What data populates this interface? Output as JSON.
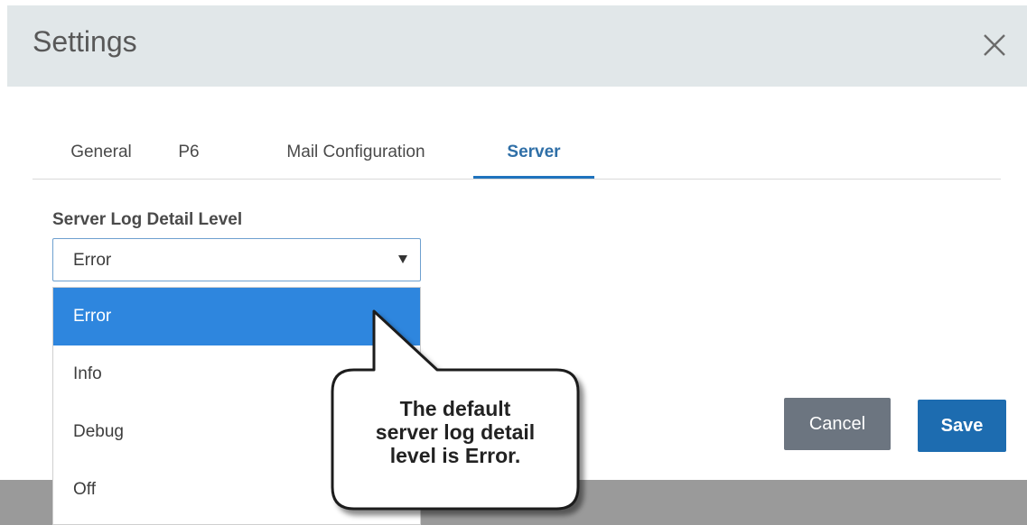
{
  "dialog": {
    "title": "Settings",
    "close_icon": "close-icon"
  },
  "tabs": [
    {
      "label": "General",
      "active": false
    },
    {
      "label": "P6",
      "active": false
    },
    {
      "label": "Mail Configuration",
      "active": false
    },
    {
      "label": "Server",
      "active": true
    }
  ],
  "server_log": {
    "label": "Server Log Detail Level",
    "selected": "Error",
    "options": [
      {
        "label": "Error",
        "highlighted": true
      },
      {
        "label": "Info",
        "highlighted": false
      },
      {
        "label": "Debug",
        "highlighted": false
      },
      {
        "label": "Off",
        "highlighted": false
      }
    ]
  },
  "buttons": {
    "cancel": "Cancel",
    "save": "Save"
  },
  "callout": {
    "lines": [
      "The default",
      "server log detail",
      "level is Error."
    ]
  },
  "colors": {
    "header_bg": "#e1e7e9",
    "active_tab": "#1f73bd",
    "selected_option": "#2e86de",
    "cancel_button": "#6c7580",
    "save_button": "#1d6cb0"
  }
}
